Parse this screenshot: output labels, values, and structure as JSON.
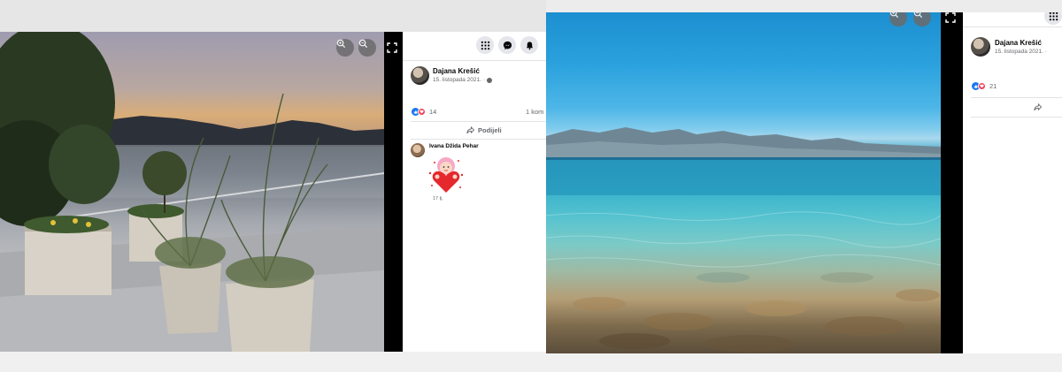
{
  "left": {
    "author_name": "Dajana Krešić",
    "post_date": "15. listopada 2021.",
    "reaction_count": "14",
    "comments_label": "1 kom",
    "share_label": "Podijeli",
    "comment": {
      "author": "Ivana Džida Pehar",
      "time": "17 tj."
    },
    "icons": [
      "zoom-in-icon",
      "zoom-out-icon",
      "expand-icon",
      "menu-grid-icon",
      "messenger-icon",
      "notifications-bell-icon",
      "globe-icon",
      "share-icon",
      "like-reaction-icon",
      "love-reaction-icon"
    ]
  },
  "right": {
    "author_name": "Dajana Krešić",
    "post_date": "15. listopada 2021. ·",
    "reaction_count": "21",
    "icons": [
      "zoom-in-icon",
      "zoom-out-icon",
      "expand-icon",
      "menu-grid-icon",
      "share-icon",
      "like-reaction-icon",
      "love-reaction-icon"
    ]
  },
  "colors": {
    "facebook_blue": "#1877f2",
    "love_red": "#f33e58",
    "secondary_text": "#65676b"
  }
}
